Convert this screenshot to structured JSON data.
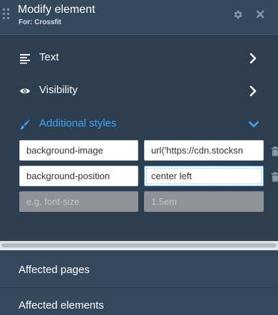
{
  "header": {
    "title": "Modify element",
    "subtitle": "For: Crossfit",
    "settings_icon": "gear-icon",
    "close_icon": "close-icon"
  },
  "menu": {
    "text": {
      "label": "Text",
      "icon": "text-align-icon"
    },
    "visibility": {
      "label": "Visibility",
      "icon": "eye-icon"
    },
    "additional_styles": {
      "label": "Additional styles",
      "icon": "paintbrush-icon",
      "expanded": true
    }
  },
  "styles": {
    "rows": [
      {
        "property": "background-image",
        "value": "url('https://cdn.stocksn"
      },
      {
        "property": "background-position",
        "value": "center left"
      }
    ],
    "new_row": {
      "property_placeholder": "e.g. font-size",
      "value_placeholder": "1.5em"
    }
  },
  "sections": {
    "affected_pages": "Affected pages",
    "affected_elements": "Affected elements"
  },
  "colors": {
    "accent": "#42a5f5",
    "panel_bg": "#2c3e50",
    "header_bg": "#35495e"
  }
}
